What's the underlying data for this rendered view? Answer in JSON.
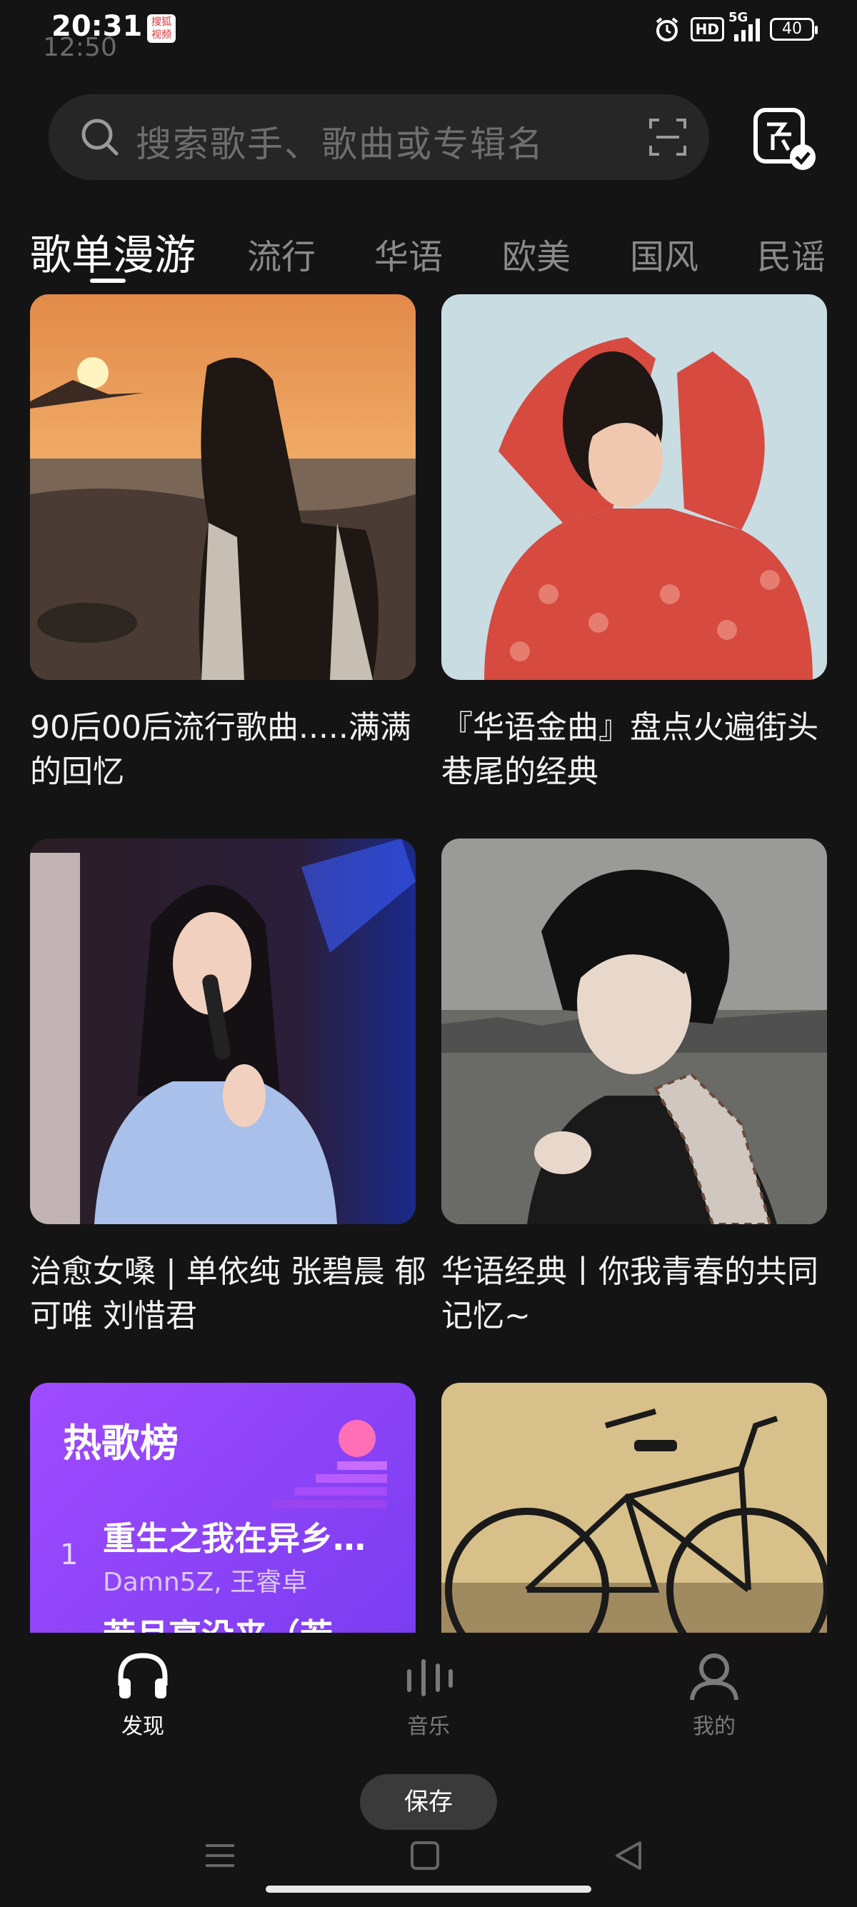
{
  "status_bar": {
    "time": "20:31",
    "ghost_time": "12:50",
    "app_badge": "搜狐视频",
    "hd": "HD",
    "network": "5G",
    "battery": "40"
  },
  "search": {
    "placeholder": "搜索歌手、歌曲或专辑名"
  },
  "tabs": [
    {
      "label": "歌单漫游",
      "active": true
    },
    {
      "label": "流行"
    },
    {
      "label": "华语"
    },
    {
      "label": "欧美"
    },
    {
      "label": "国风"
    },
    {
      "label": "民谣"
    }
  ],
  "playlists": [
    {
      "title": "90后00后流行歌曲.....满满的回忆"
    },
    {
      "title": "『华语金曲』盘点火遍街头巷尾的经典"
    },
    {
      "title": "治愈女嗓 | 单依纯  张碧晨  郁可唯  刘惜君"
    },
    {
      "title": "华语经典丨你我青春的共同记忆~"
    }
  ],
  "hot_chart": {
    "title": "热歌榜",
    "rank": "1",
    "song": "重生之我在异乡…",
    "artist": "Damn5Z, 王睿卓",
    "next_song": "若月亮没来（若"
  },
  "bottom_nav": [
    {
      "label": "发现",
      "active": true
    },
    {
      "label": "音乐"
    },
    {
      "label": "我的"
    }
  ],
  "save_label": "保存"
}
